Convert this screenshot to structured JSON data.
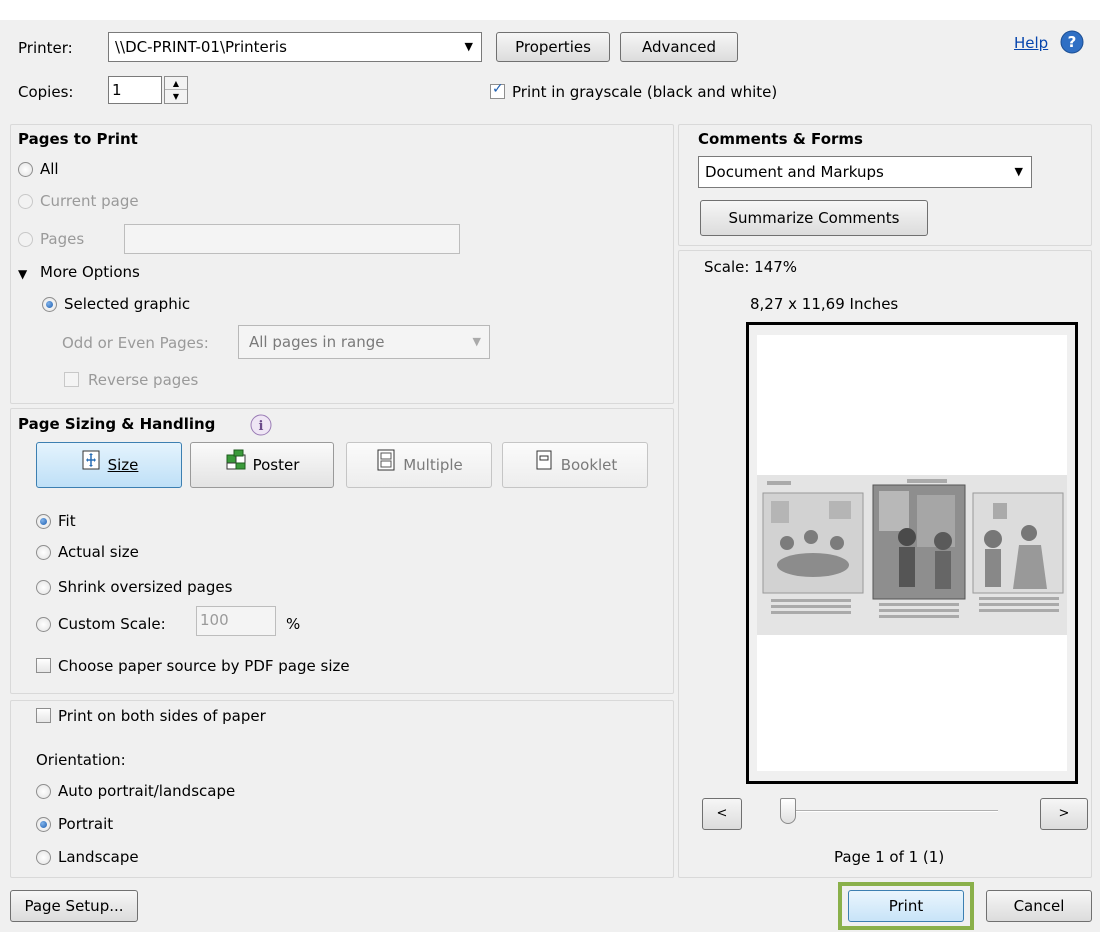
{
  "printer": {
    "label": "Printer:",
    "selected": "\\\\DC-PRINT-01\\Printeris",
    "properties_label": "Properties",
    "advanced_label": "Advanced",
    "help_label": "Help"
  },
  "copies": {
    "label": "Copies:",
    "value": "1",
    "grayscale_label": "Print in grayscale (black and white)",
    "grayscale_checked": true
  },
  "pages_to_print": {
    "title": "Pages to Print",
    "all_label": "All",
    "current_page_label": "Current page",
    "pages_label": "Pages",
    "pages_value": "",
    "more_options_label": "More Options",
    "selected_graphic_label": "Selected graphic",
    "odd_even_label": "Odd or Even Pages:",
    "odd_even_value": "All pages in range",
    "reverse_label": "Reverse pages"
  },
  "sizing": {
    "title": "Page Sizing & Handling",
    "modes": [
      {
        "label": "Size"
      },
      {
        "label": "Poster"
      },
      {
        "label": "Multiple"
      },
      {
        "label": "Booklet"
      }
    ],
    "fit_label": "Fit",
    "actual_label": "Actual size",
    "shrink_label": "Shrink oversized pages",
    "custom_label": "Custom Scale:",
    "custom_value": "100",
    "percent": "%",
    "paper_source_label": "Choose paper source by PDF page size"
  },
  "duplex": {
    "both_sides_label": "Print on both sides of paper",
    "orientation_label": "Orientation:",
    "auto_label": "Auto portrait/landscape",
    "portrait_label": "Portrait",
    "landscape_label": "Landscape"
  },
  "comments": {
    "title": "Comments & Forms",
    "selected": "Document and Markups",
    "summarize_label": "Summarize Comments"
  },
  "preview": {
    "scale_text": "Scale: 147%",
    "dimensions": "8,27 x 11,69 Inches",
    "prev_label": "<",
    "next_label": ">",
    "page_status": "Page 1 of 1 (1)",
    "slider_position": 0
  },
  "footer": {
    "page_setup_label": "Page Setup...",
    "print_label": "Print",
    "cancel_label": "Cancel"
  },
  "colors": {
    "accent": "#1f5fb0",
    "print_highlight": "#8ab04a",
    "help_link": "#0645ad"
  }
}
